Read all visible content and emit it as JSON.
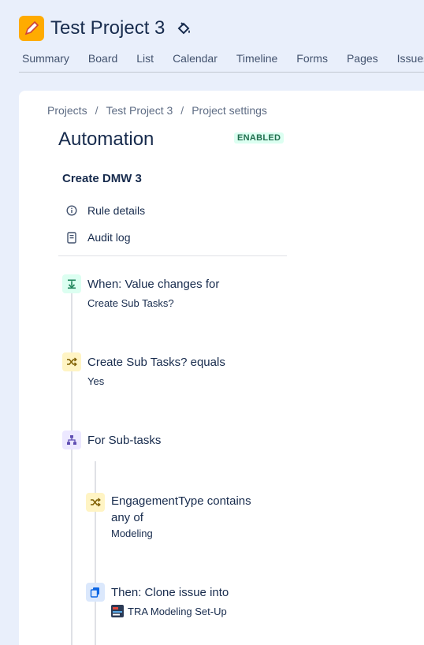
{
  "header": {
    "project_title": "Test Project 3",
    "nav": [
      "Summary",
      "Board",
      "List",
      "Calendar",
      "Timeline",
      "Forms",
      "Pages",
      "Issues"
    ]
  },
  "breadcrumb": {
    "projects": "Projects",
    "sep": "/",
    "project": "Test Project 3",
    "settings": "Project settings"
  },
  "page": {
    "title": "Automation",
    "status": "ENABLED"
  },
  "rule": {
    "name": "Create DMW 3",
    "menu": {
      "details": "Rule details",
      "audit": "Audit log"
    }
  },
  "steps": {
    "trigger": {
      "title": "When: Value changes for",
      "sub": "Create Sub Tasks?"
    },
    "condition": {
      "title": "Create Sub Tasks? equals",
      "sub": "Yes"
    },
    "branch": {
      "title": "For Sub-tasks"
    },
    "sub_condition": {
      "title_line1": "EngagementType contains",
      "title_line2": "any of",
      "sub": "Modeling"
    },
    "action": {
      "title": "Then: Clone issue into",
      "sub": "TRA Modeling Set-Up"
    }
  },
  "colors": {
    "accent": "#ffab00",
    "enabled_badge_bg": "#dcfff1",
    "enabled_badge_text": "#216e4e",
    "trigger_bg": "#dcfff1",
    "condition_bg": "#fff4c4",
    "branch_bg": "#ece8ff",
    "action_bg": "#dbe8fc"
  }
}
